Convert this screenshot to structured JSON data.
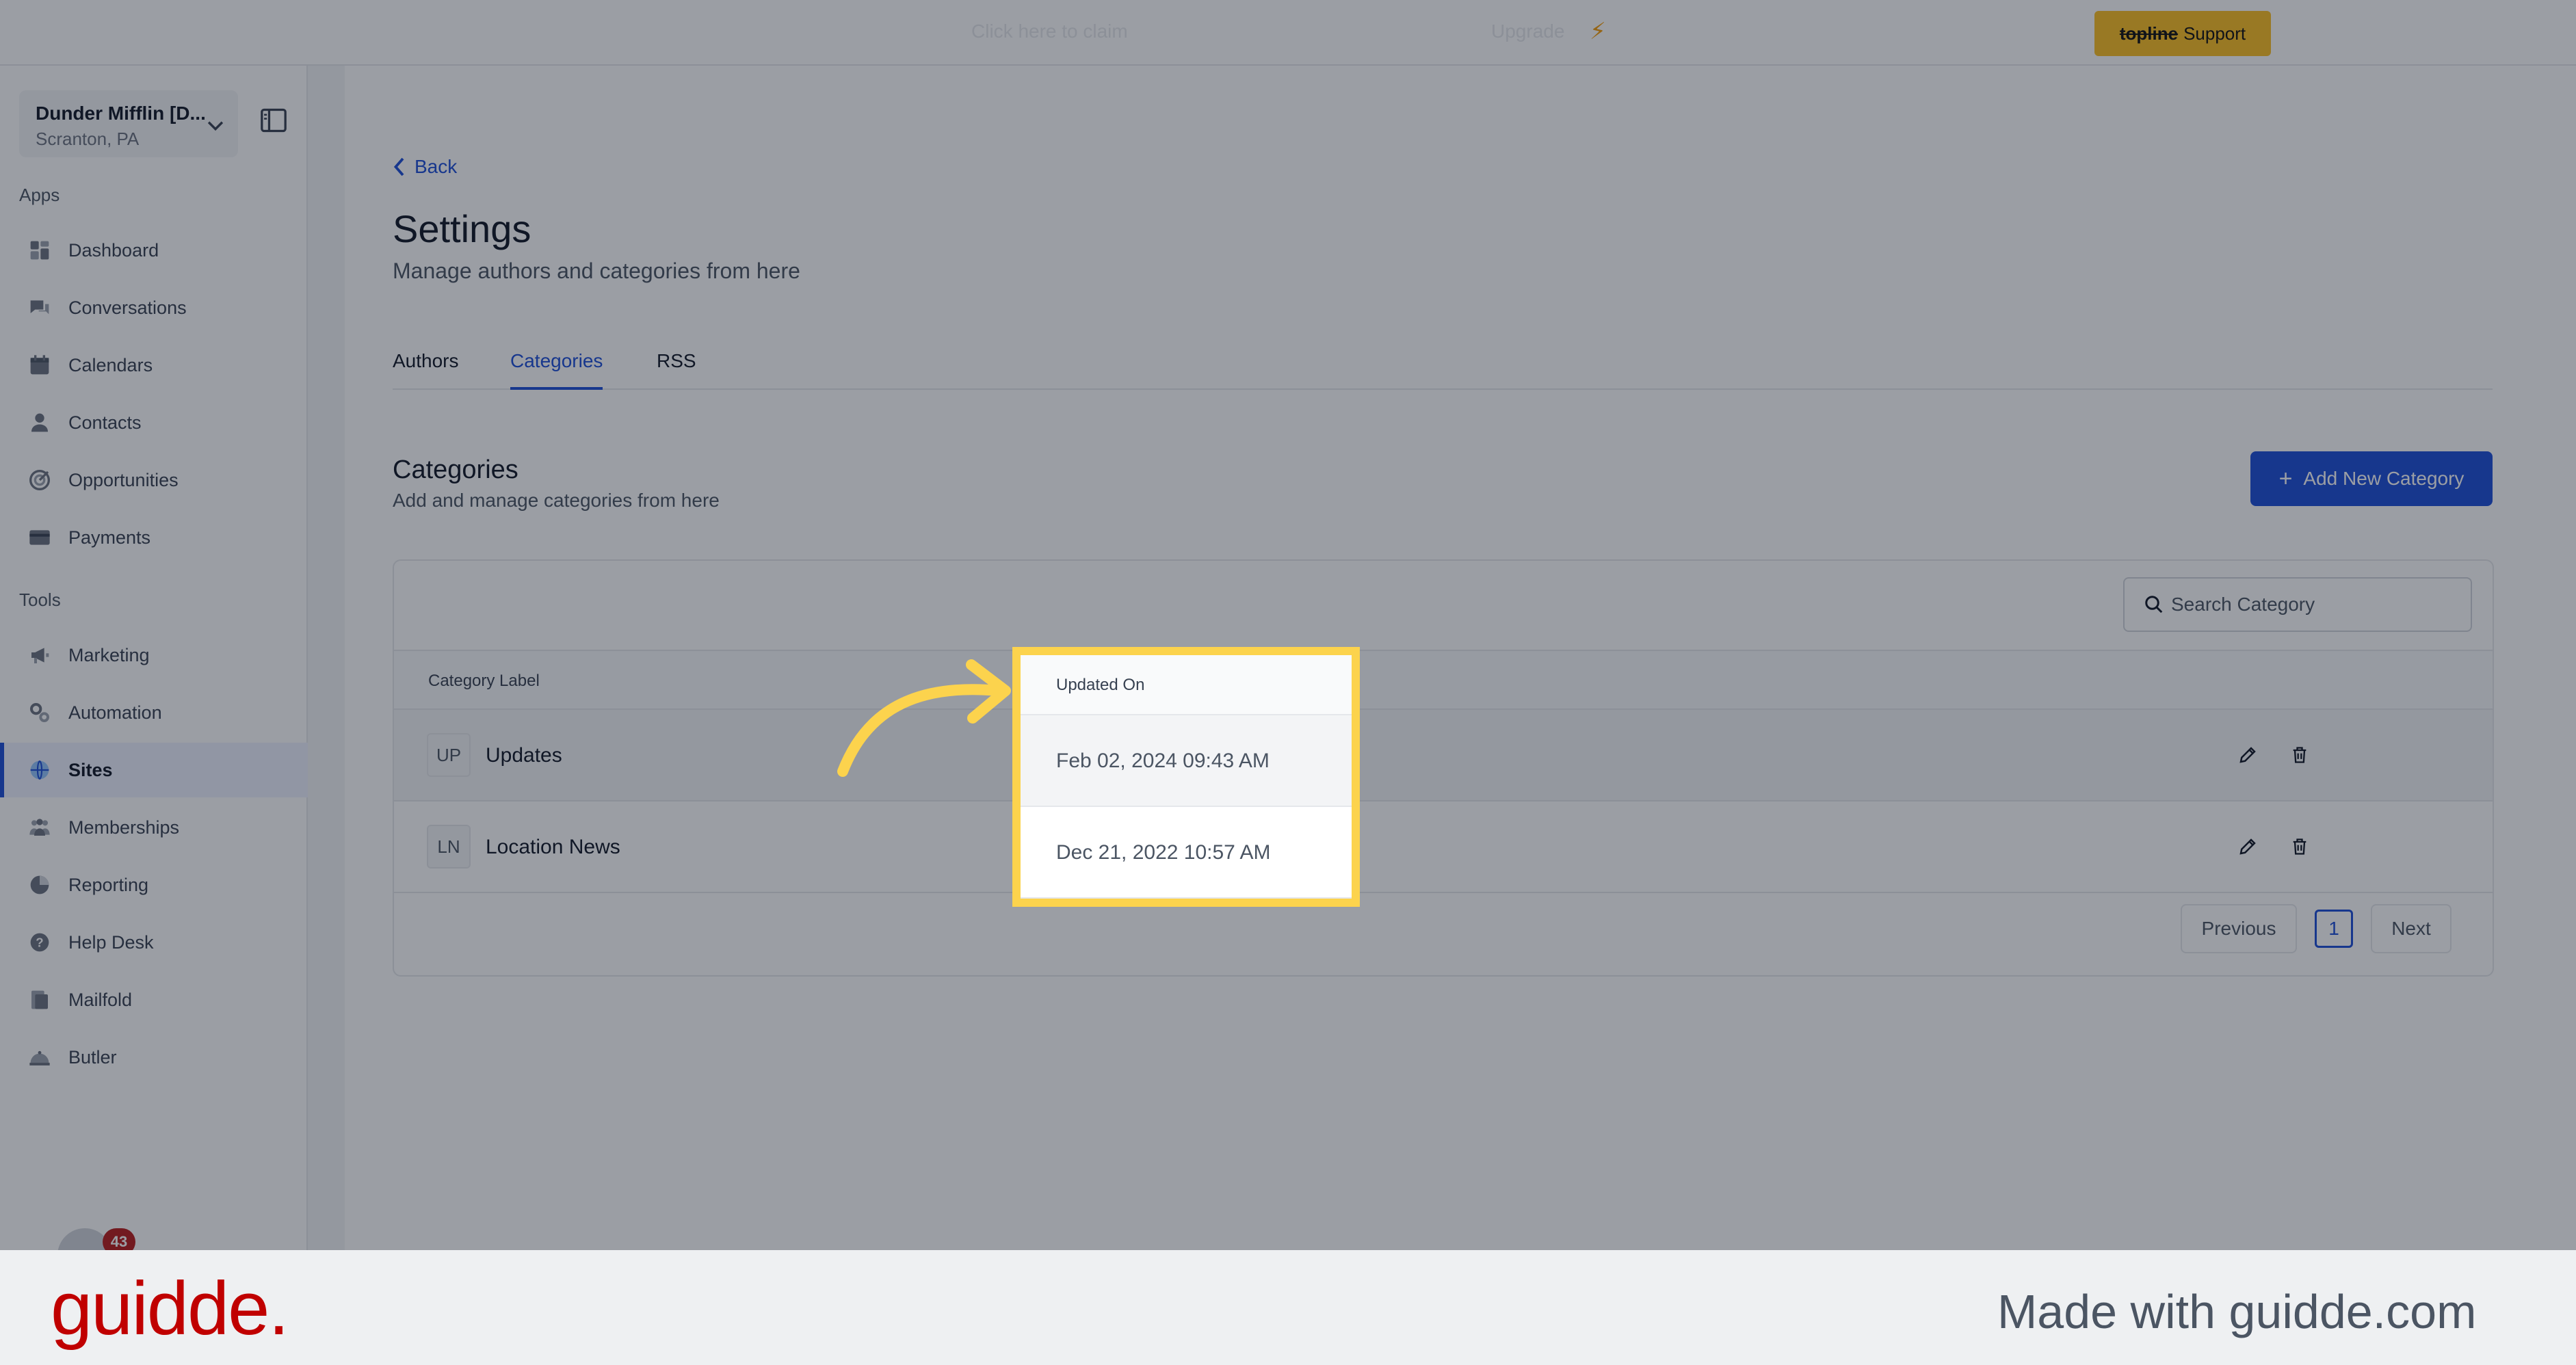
{
  "topbar": {
    "faint_text_1": "Click here to claim",
    "faint_text_2": "Upgrade",
    "support": {
      "brand": "topline",
      "label": "Support"
    }
  },
  "sidebar": {
    "account": {
      "name": "Dunder Mifflin [D...",
      "location": "Scranton, PA"
    },
    "apps_label": "Apps",
    "tools_label": "Tools",
    "apps": [
      {
        "label": "Dashboard",
        "icon": "dashboard-icon"
      },
      {
        "label": "Conversations",
        "icon": "chat-icon"
      },
      {
        "label": "Calendars",
        "icon": "calendar-icon"
      },
      {
        "label": "Contacts",
        "icon": "person-icon"
      },
      {
        "label": "Opportunities",
        "icon": "target-icon"
      },
      {
        "label": "Payments",
        "icon": "card-icon"
      }
    ],
    "tools": [
      {
        "label": "Marketing",
        "icon": "megaphone-icon"
      },
      {
        "label": "Automation",
        "icon": "gears-icon"
      },
      {
        "label": "Sites",
        "icon": "globe-icon",
        "active": true
      },
      {
        "label": "Memberships",
        "icon": "people-icon"
      },
      {
        "label": "Reporting",
        "icon": "pie-icon"
      },
      {
        "label": "Help Desk",
        "icon": "help-icon"
      },
      {
        "label": "Mailfold",
        "icon": "mail-icon"
      },
      {
        "label": "Butler",
        "icon": "butler-icon"
      }
    ],
    "notification_count": "43"
  },
  "main": {
    "back_label": "Back",
    "title": "Settings",
    "subtitle": "Manage authors and categories from here",
    "tabs": [
      {
        "label": "Authors"
      },
      {
        "label": "Categories",
        "active": true
      },
      {
        "label": "RSS"
      }
    ],
    "section": {
      "title": "Categories",
      "subtitle": "Add and manage categories from here",
      "add_button": "Add New Category"
    },
    "search": {
      "placeholder": "Search Category"
    },
    "table": {
      "columns": [
        "Category Label",
        "Updated On"
      ],
      "rows": [
        {
          "initials": "UP",
          "label": "Updates",
          "updated": "Feb 02, 2024 09:43 AM"
        },
        {
          "initials": "LN",
          "label": "Location News",
          "updated": "Dec 21, 2022 10:57 AM"
        }
      ]
    },
    "pagination": {
      "previous": "Previous",
      "page": "1",
      "next": "Next"
    }
  },
  "footer": {
    "logo": "guidde.",
    "made_with": "Made with guidde.com"
  },
  "colors": {
    "accent": "#1d4ed8",
    "highlight": "#fcd34d",
    "support": "#fbbf24",
    "brand_red": "#c00000"
  }
}
